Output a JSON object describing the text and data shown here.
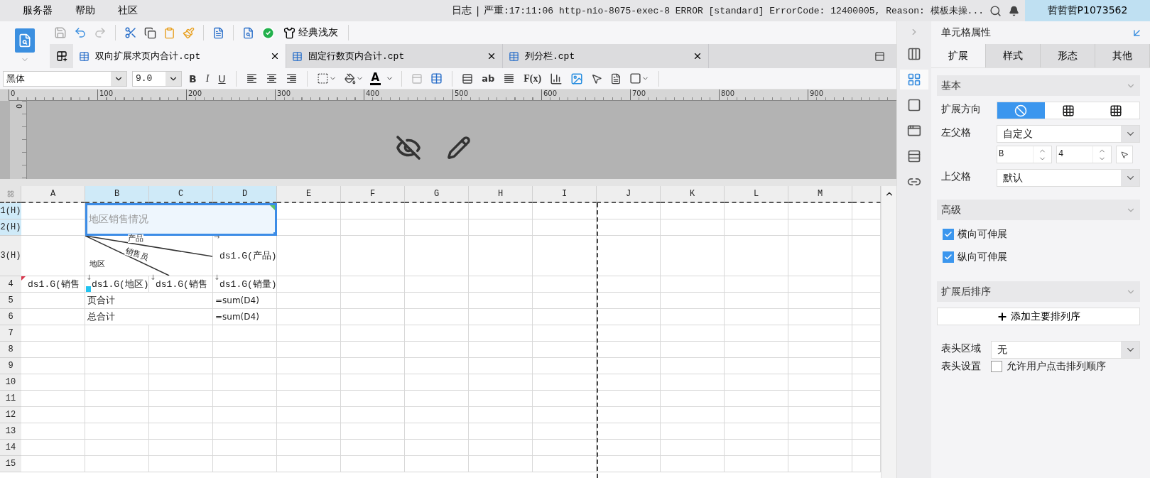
{
  "menu": [
    {
      "label": "服务器"
    },
    {
      "label": "帮助"
    },
    {
      "label": "社区"
    }
  ],
  "log": {
    "label": "日志",
    "separator": "|",
    "severity": "严重",
    "message": ":17:11:06 http-nio-8075-exec-8 ERROR [standard] ErrorCode: 12400005, Reason: 模板未操..."
  },
  "user": {
    "name": "哲哲哲P1073562"
  },
  "toolbar": {
    "theme": "经典浅灰"
  },
  "tabs": [
    {
      "label": "双向扩展求页内合计.cpt",
      "selected": true
    },
    {
      "label": "固定行数页内合计.cpt",
      "selected": false
    },
    {
      "label": "列分栏.cpt",
      "selected": false
    }
  ],
  "format_bar": {
    "font": "黑体",
    "size": "9.0",
    "bold": "B",
    "italic": "I",
    "underline": "U",
    "font_color": "A",
    "text_tool": "ab",
    "formula": "F(x)"
  },
  "ruler": {
    "marks": [
      "0",
      "100",
      "200",
      "300",
      "400",
      "500",
      "600",
      "700",
      "800",
      "900"
    ],
    "vertical_mark": "0"
  },
  "sheet": {
    "columns": [
      {
        "label": "A",
        "selected": false
      },
      {
        "label": "B",
        "selected": true
      },
      {
        "label": "C",
        "selected": true
      },
      {
        "label": "D",
        "selected": true
      },
      {
        "label": "E",
        "selected": false
      },
      {
        "label": "F",
        "selected": false
      },
      {
        "label": "G",
        "selected": false
      },
      {
        "label": "H",
        "selected": false
      },
      {
        "label": "I",
        "selected": false
      },
      {
        "label": "J",
        "selected": false
      },
      {
        "label": "K",
        "selected": false
      },
      {
        "label": "L",
        "selected": false
      },
      {
        "label": "M",
        "selected": false
      }
    ],
    "rows": [
      {
        "label": "1(H)",
        "selected": true,
        "cells": [
          {
            "kind": "blank"
          },
          {
            "kind": "title",
            "text": "地区销售情况",
            "selected": true
          }
        ]
      },
      {
        "label": "2(H)",
        "selected": true
      },
      {
        "label": "3(H)",
        "selected": false,
        "cells": [
          {
            "kind": "blank"
          },
          {
            "kind": "diagonal",
            "labels": [
              "产品",
              "销售员",
              "地区"
            ]
          },
          {
            "kind": "field",
            "text": "ds1.G(产品)",
            "expand": "→",
            "flag": false,
            "marker": false
          }
        ]
      },
      {
        "label": "4",
        "selected": false,
        "cells": [
          {
            "kind": "field",
            "text": "ds1.G(销售",
            "flag": true,
            "marker": false
          },
          {
            "kind": "field",
            "text": "ds1.G(地区)",
            "expand": "↓",
            "flag": false,
            "marker": true
          },
          {
            "kind": "field",
            "text": "ds1.G(销售",
            "expand": "↓",
            "flag": false,
            "marker": false
          },
          {
            "kind": "field",
            "text": "ds1.G(销量)",
            "expand": "↓",
            "flag": false,
            "marker": false
          }
        ]
      },
      {
        "label": "5",
        "selected": false,
        "cells": [
          {
            "kind": "blank"
          },
          {
            "kind": "wide",
            "text": "页合计"
          },
          {
            "kind": "formula",
            "text": "=sum(D4)"
          }
        ]
      },
      {
        "label": "6",
        "selected": false,
        "cells": [
          {
            "kind": "blank"
          },
          {
            "kind": "wide",
            "text": "总合计"
          },
          {
            "kind": "formula",
            "text": "=sum(D4)"
          }
        ]
      },
      {
        "label": "7",
        "selected": false
      },
      {
        "label": "8",
        "selected": false
      },
      {
        "label": "9",
        "selected": false
      },
      {
        "label": "10",
        "selected": false
      },
      {
        "label": "11",
        "selected": false
      },
      {
        "label": "12",
        "selected": false
      },
      {
        "label": "13",
        "selected": false
      },
      {
        "label": "14",
        "selected": false
      },
      {
        "label": "15",
        "selected": false
      }
    ]
  },
  "side_tools": [
    {
      "kind": "layout",
      "selected": false
    },
    {
      "kind": "cell",
      "selected": true
    },
    {
      "kind": "frame",
      "selected": false
    },
    {
      "kind": "widget",
      "selected": false
    },
    {
      "kind": "rows",
      "selected": false
    },
    {
      "kind": "link",
      "selected": false
    }
  ],
  "panel": {
    "title": "单元格属性",
    "tabs": [
      {
        "label": "扩展",
        "selected": true
      },
      {
        "label": "样式",
        "selected": false
      },
      {
        "label": "形态",
        "selected": false
      },
      {
        "label": "其他",
        "selected": false
      }
    ],
    "basic": {
      "title": "基本",
      "direction": {
        "label": "扩展方向",
        "options": [
          {
            "kind": "none",
            "selected": true
          },
          {
            "kind": "vertical",
            "selected": false
          },
          {
            "kind": "horizontal",
            "selected": false
          }
        ]
      },
      "left_parent": {
        "label": "左父格",
        "value": "自定义",
        "column": "B",
        "row": "4"
      },
      "top_parent": {
        "label": "上父格",
        "value": "默认"
      }
    },
    "advanced": {
      "title": "高级",
      "options": [
        {
          "label": "横向可伸展",
          "checked": true
        },
        {
          "label": "纵向可伸展",
          "checked": true
        }
      ]
    },
    "sorting": {
      "title": "扩展后排序",
      "add_button": "添加主要排列序",
      "header_area": {
        "label": "表头区域",
        "value": "无"
      },
      "header_setting": {
        "label": "表头设置",
        "option": "允许用户点击排列顺序",
        "checked": false
      }
    }
  }
}
